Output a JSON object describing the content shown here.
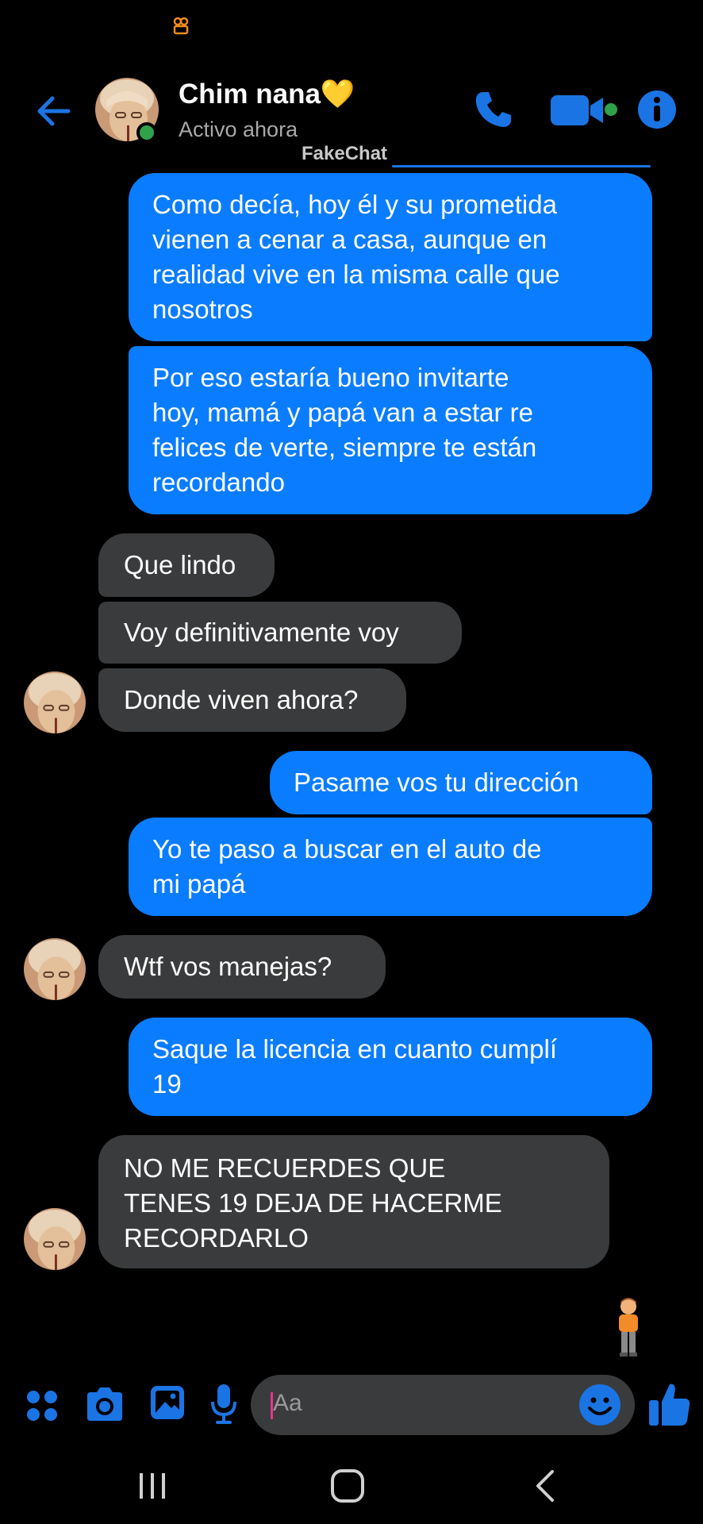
{
  "header": {
    "contact_name": "Chim nana💛",
    "status": "Activo ahora",
    "watermark": "FakeChat"
  },
  "colors": {
    "accent": "#0a7cff",
    "their_bubble": "#3a3b3c",
    "online": "#31a24c",
    "background": "#000000"
  },
  "icons": {
    "status_app": "app-notification-icon",
    "back": "back-arrow-icon",
    "call": "phone-icon",
    "video": "video-camera-icon",
    "info": "info-icon",
    "menu": "four-dots-icon",
    "camera": "camera-icon",
    "gallery": "image-icon",
    "mic": "microphone-icon",
    "emoji": "smiley-icon",
    "like": "thumbs-up-icon",
    "read_receipt": "person-emoji-icon"
  },
  "messages": [
    {
      "sender": "me",
      "text": "Como decía, hoy él y su prometida\nvienen a cenar a casa, aunque en\nrealidad vive en la misma calle que\nnosotros"
    },
    {
      "sender": "me",
      "text": "Por eso estaría bueno invitarte\nhoy, mamá y papá van a estar re\nfelices de verte, siempre te están\nrecordando"
    },
    {
      "sender": "them",
      "text": "Que lindo"
    },
    {
      "sender": "them",
      "text": "Voy definitivamente voy"
    },
    {
      "sender": "them",
      "text": "Donde viven ahora?"
    },
    {
      "sender": "me",
      "text": "Pasame vos tu dirección"
    },
    {
      "sender": "me",
      "text": "Yo te paso a buscar en el auto de\nmi papá"
    },
    {
      "sender": "them",
      "text": "Wtf vos manejas?"
    },
    {
      "sender": "me",
      "text": "Saque la licencia en cuanto cumplí\n19"
    },
    {
      "sender": "them",
      "text": "NO ME RECUERDES QUE\nTENES 19 DEJA DE HACERME\nRECORDARLO"
    }
  ],
  "composer": {
    "placeholder": "Aa"
  },
  "navigation": {
    "recent": "recent-apps-icon",
    "home": "home-icon",
    "back": "nav-back-icon"
  }
}
